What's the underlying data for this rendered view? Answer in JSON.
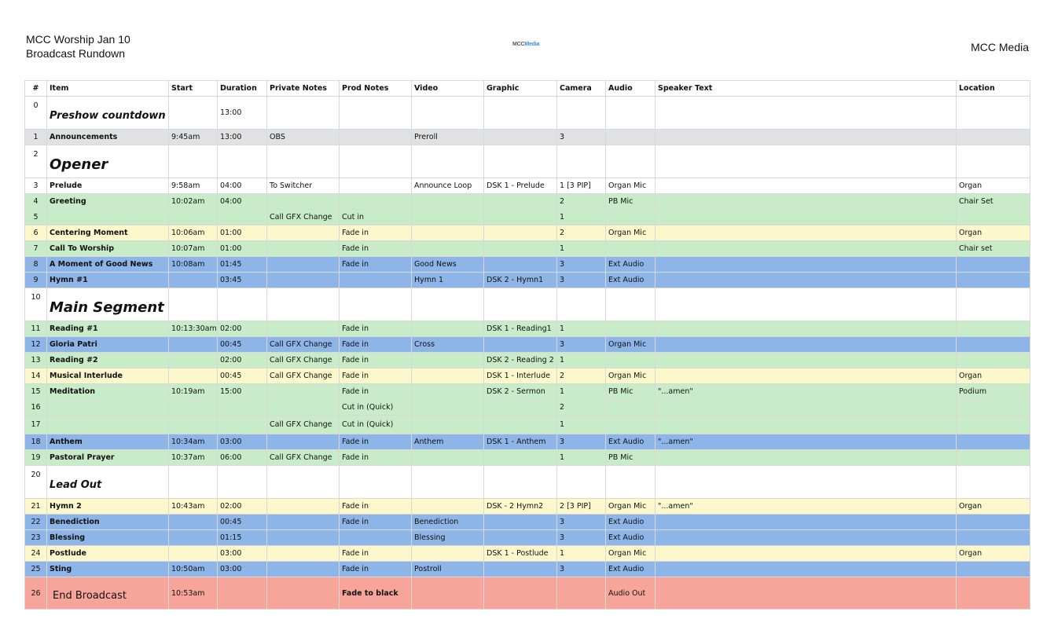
{
  "header": {
    "title_line1": "MCC Worship Jan 10",
    "title_line2": "Broadcast Rundown",
    "logo_mcc": "MCC",
    "logo_media": "Media",
    "org_name": "MCC Media"
  },
  "colors": {
    "white": "#ffffff",
    "gray": "#dfe1e4",
    "green": "#c9ecc8",
    "yellow": "#fdf8cc",
    "blue": "#8eb5e8",
    "red": "#f7a59a"
  },
  "columns": [
    "#",
    "Item",
    "Start",
    "Duration",
    "Private Notes",
    "Prod Notes",
    "Video",
    "Graphic",
    "Camera",
    "Audio",
    "Speaker Text",
    "Location"
  ],
  "rows": [
    {
      "num": "0",
      "item": "Preshow countdown",
      "start": "",
      "duration": "13:00",
      "private_notes": "",
      "prod_notes": "",
      "video": "",
      "graphic": "",
      "camera": "",
      "audio": "",
      "speaker_text": "",
      "location": "",
      "color": "white",
      "segment": "small"
    },
    {
      "num": "1",
      "item": "Announcements",
      "start": "9:45am",
      "duration": "13:00",
      "private_notes": "OBS",
      "prod_notes": "",
      "video": "Preroll",
      "graphic": "",
      "camera": "3",
      "audio": "",
      "speaker_text": "",
      "location": "",
      "color": "gray"
    },
    {
      "num": "2",
      "item": "Opener",
      "start": "",
      "duration": "",
      "private_notes": "",
      "prod_notes": "",
      "video": "",
      "graphic": "",
      "camera": "",
      "audio": "",
      "speaker_text": "",
      "location": "",
      "color": "white",
      "segment": "big"
    },
    {
      "num": "3",
      "item": "Prelude",
      "start": "9:58am",
      "duration": "04:00",
      "private_notes": "To Switcher",
      "prod_notes": "",
      "video": "Announce Loop",
      "graphic": "DSK 1 - Prelude",
      "camera": "1 [3 PIP]",
      "audio": "Organ Mic",
      "speaker_text": "",
      "location": "Organ",
      "color": "white"
    },
    {
      "num": "4",
      "item": "Greeting",
      "start": "10:02am",
      "duration": "04:00",
      "private_notes": "",
      "prod_notes": "",
      "video": "",
      "graphic": "",
      "camera": "2",
      "audio": "PB Mic",
      "speaker_text": "",
      "location": "Chair Set",
      "color": "green"
    },
    {
      "num": "5",
      "item": "",
      "start": "",
      "duration": "",
      "private_notes": "Call GFX Change",
      "prod_notes": "Cut in",
      "video": "",
      "graphic": "",
      "camera": "1",
      "audio": "",
      "speaker_text": "",
      "location": "",
      "color": "green"
    },
    {
      "num": "6",
      "item": "Centering Moment",
      "start": "10:06am",
      "duration": "01:00",
      "private_notes": "",
      "prod_notes": "Fade in",
      "video": "",
      "graphic": "",
      "camera": "2",
      "audio": "Organ Mic",
      "speaker_text": "",
      "location": "Organ",
      "color": "yellow"
    },
    {
      "num": "7",
      "item": "Call To Worship",
      "start": "10:07am",
      "duration": "01:00",
      "private_notes": "",
      "prod_notes": "Fade in",
      "video": "",
      "graphic": "",
      "camera": "1",
      "audio": "",
      "speaker_text": "",
      "location": "Chair set",
      "color": "green"
    },
    {
      "num": "8",
      "item": "A Moment of Good News",
      "start": "10:08am",
      "duration": "01:45",
      "private_notes": "",
      "prod_notes": "Fade in",
      "video": "Good News",
      "graphic": "",
      "camera": "3",
      "audio": "Ext Audio",
      "speaker_text": "",
      "location": "",
      "color": "blue"
    },
    {
      "num": "9",
      "item": "Hymn #1",
      "start": "",
      "duration": "03:45",
      "private_notes": "",
      "prod_notes": "",
      "video": "Hymn 1",
      "graphic": "DSK 2 - Hymn1",
      "camera": "3",
      "audio": "Ext Audio",
      "speaker_text": "",
      "location": "",
      "color": "blue"
    },
    {
      "num": "10",
      "item": "Main Segment",
      "start": "",
      "duration": "",
      "private_notes": "",
      "prod_notes": "",
      "video": "",
      "graphic": "",
      "camera": "",
      "audio": "",
      "speaker_text": "",
      "location": "",
      "color": "white",
      "segment": "big"
    },
    {
      "num": "11",
      "item": "Reading #1",
      "start": "10:13:30am",
      "duration": "02:00",
      "private_notes": "",
      "prod_notes": "Fade in",
      "video": "",
      "graphic": "DSK 1 - Reading1",
      "camera": "1",
      "audio": "",
      "speaker_text": "",
      "location": "",
      "color": "green"
    },
    {
      "num": "12",
      "item": "Gloria Patri",
      "start": "",
      "duration": "00:45",
      "private_notes": "Call GFX Change",
      "prod_notes": "Fade in",
      "video": "Cross",
      "graphic": "",
      "camera": "3",
      "audio": "Organ Mic",
      "speaker_text": "",
      "location": "",
      "color": "blue"
    },
    {
      "num": "13",
      "item": "Reading #2",
      "start": "",
      "duration": "02:00",
      "private_notes": "Call GFX Change",
      "prod_notes": "Fade in",
      "video": "",
      "graphic": "DSK 2 - Reading 2",
      "camera": "1",
      "audio": "",
      "speaker_text": "",
      "location": "",
      "color": "green"
    },
    {
      "num": "14",
      "item": "Musical Interlude",
      "start": "",
      "duration": "00:45",
      "private_notes": "Call GFX Change",
      "prod_notes": "Fade in",
      "video": "",
      "graphic": "DSK 1 - Interlude",
      "camera": "2",
      "audio": "Organ Mic",
      "speaker_text": "",
      "location": "Organ",
      "color": "yellow"
    },
    {
      "num": "15",
      "item": "Meditation",
      "start": "10:19am",
      "duration": "15:00",
      "private_notes": "",
      "prod_notes": "Fade in",
      "video": "",
      "graphic": "DSK 2 - Sermon",
      "camera": "1",
      "audio": "PB Mic",
      "speaker_text": "\"...amen\"",
      "location": "Podium",
      "color": "green"
    },
    {
      "num": "16",
      "item": "",
      "start": "",
      "duration": "",
      "private_notes": "",
      "prod_notes": "Cut in (Quick)",
      "video": "",
      "graphic": "",
      "camera": "2",
      "audio": "",
      "speaker_text": "",
      "location": "",
      "color": "green"
    },
    {
      "num": "17",
      "item": "",
      "start": "",
      "duration": "",
      "private_notes": "Call GFX Change",
      "prod_notes": "Cut in (Quick)",
      "video": "",
      "graphic": "",
      "camera": "1",
      "audio": "",
      "speaker_text": "",
      "location": "",
      "color": "green",
      "tall": true
    },
    {
      "num": "18",
      "item": "Anthem",
      "start": "10:34am",
      "duration": "03:00",
      "private_notes": "",
      "prod_notes": "Fade in",
      "video": "Anthem",
      "graphic": "DSK 1 - Anthem",
      "camera": "3",
      "audio": "Ext Audio",
      "speaker_text": "\"...amen\"",
      "location": "",
      "color": "blue"
    },
    {
      "num": "19",
      "item": "Pastoral Prayer",
      "start": "10:37am",
      "duration": "06:00",
      "private_notes": "Call GFX Change",
      "prod_notes": "Fade in",
      "video": "",
      "graphic": "",
      "camera": "1",
      "audio": "PB Mic",
      "speaker_text": "",
      "location": "",
      "color": "green"
    },
    {
      "num": "20",
      "item": "Lead Out",
      "start": "",
      "duration": "",
      "private_notes": "",
      "prod_notes": "",
      "video": "",
      "graphic": "",
      "camera": "",
      "audio": "",
      "speaker_text": "",
      "location": "",
      "color": "white",
      "segment": "small"
    },
    {
      "num": "21",
      "item": "Hymn 2",
      "start": "10:43am",
      "duration": "02:00",
      "private_notes": "",
      "prod_notes": "Fade in",
      "video": "",
      "graphic": "DSK - 2 Hymn2",
      "camera": "2 [3 PIP]",
      "audio": "Organ Mic",
      "speaker_text": "\"...amen\"",
      "location": "Organ",
      "color": "yellow"
    },
    {
      "num": "22",
      "item": "Benediction",
      "start": "",
      "duration": "00:45",
      "private_notes": "",
      "prod_notes": "Fade in",
      "video": "Benediction",
      "graphic": "",
      "camera": "3",
      "audio": "Ext Audio",
      "speaker_text": "",
      "location": "",
      "color": "blue"
    },
    {
      "num": "23",
      "item": "Blessing",
      "start": "",
      "duration": "01:15",
      "private_notes": "",
      "prod_notes": "",
      "video": "Blessing",
      "graphic": "",
      "camera": "3",
      "audio": "Ext Audio",
      "speaker_text": "",
      "location": "",
      "color": "blue"
    },
    {
      "num": "24",
      "item": "Postlude",
      "start": "",
      "duration": "03:00",
      "private_notes": "",
      "prod_notes": "Fade in",
      "video": "",
      "graphic": "DSK 1 - Postlude",
      "camera": "1",
      "audio": "Organ Mic",
      "speaker_text": "",
      "location": "Organ",
      "color": "yellow"
    },
    {
      "num": "25",
      "item": "Sting",
      "start": "10:50am",
      "duration": "03:00",
      "private_notes": "",
      "prod_notes": "Fade in",
      "video": "Postroll",
      "graphic": "",
      "camera": "3",
      "audio": "Ext Audio",
      "speaker_text": "",
      "location": "",
      "color": "blue"
    },
    {
      "num": "26",
      "item": "End Broadcast",
      "start": "10:53am",
      "duration": "",
      "private_notes": "",
      "prod_notes": "Fade to black",
      "video": "",
      "graphic": "",
      "camera": "",
      "audio": "Audio Out",
      "speaker_text": "",
      "location": "",
      "color": "red",
      "segment": "end"
    }
  ]
}
